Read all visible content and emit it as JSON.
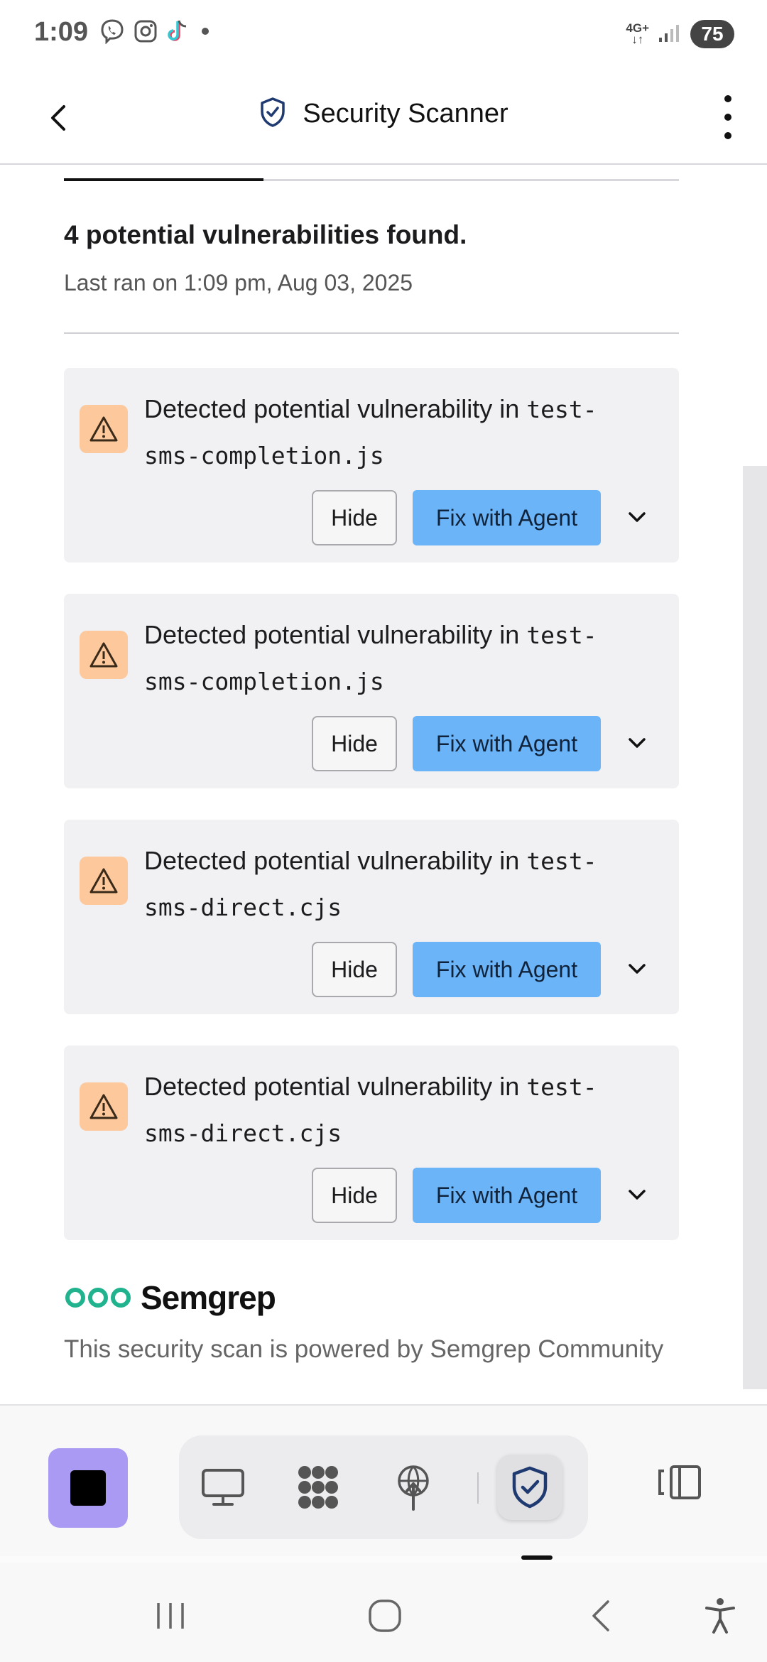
{
  "status_bar": {
    "time": "1:09",
    "network": "4G+",
    "battery": "75"
  },
  "app_bar": {
    "title": "Security Scanner"
  },
  "scan": {
    "summary": "4 potential vulnerabilities found.",
    "last_ran": "Last ran on 1:09 pm, Aug 03, 2025"
  },
  "findings": [
    {
      "prefix": "Detected potential vulnerability in ",
      "file_a": "test-",
      "file_b": "sms-completion.js",
      "hide_label": "Hide",
      "fix_label": "Fix with Agent"
    },
    {
      "prefix": "Detected potential vulnerability in ",
      "file_a": "test-",
      "file_b": "sms-completion.js",
      "hide_label": "Hide",
      "fix_label": "Fix with Agent"
    },
    {
      "prefix": "Detected potential vulnerability in ",
      "file_a": "test-",
      "file_b": "sms-direct.cjs",
      "hide_label": "Hide",
      "fix_label": "Fix with Agent"
    },
    {
      "prefix": "Detected potential vulnerability in ",
      "file_a": "test-",
      "file_b": "sms-direct.cjs",
      "hide_label": "Hide",
      "fix_label": "Fix with Agent"
    }
  ],
  "footer": {
    "brand": "Semgrep",
    "powered_by": "This security scan is powered by Semgrep Community"
  },
  "toolbar": {
    "items": [
      "stop-icon",
      "monitor-icon",
      "packages-icon",
      "deploy-icon",
      "security-shield-icon",
      "layout-toggle-icon"
    ],
    "active": "security-shield-icon"
  },
  "colors": {
    "accent_button": "#6bb4f8",
    "warning_badge": "#fcc89c",
    "stop_button": "#ab9af4",
    "semgrep_green": "#20b38e"
  }
}
